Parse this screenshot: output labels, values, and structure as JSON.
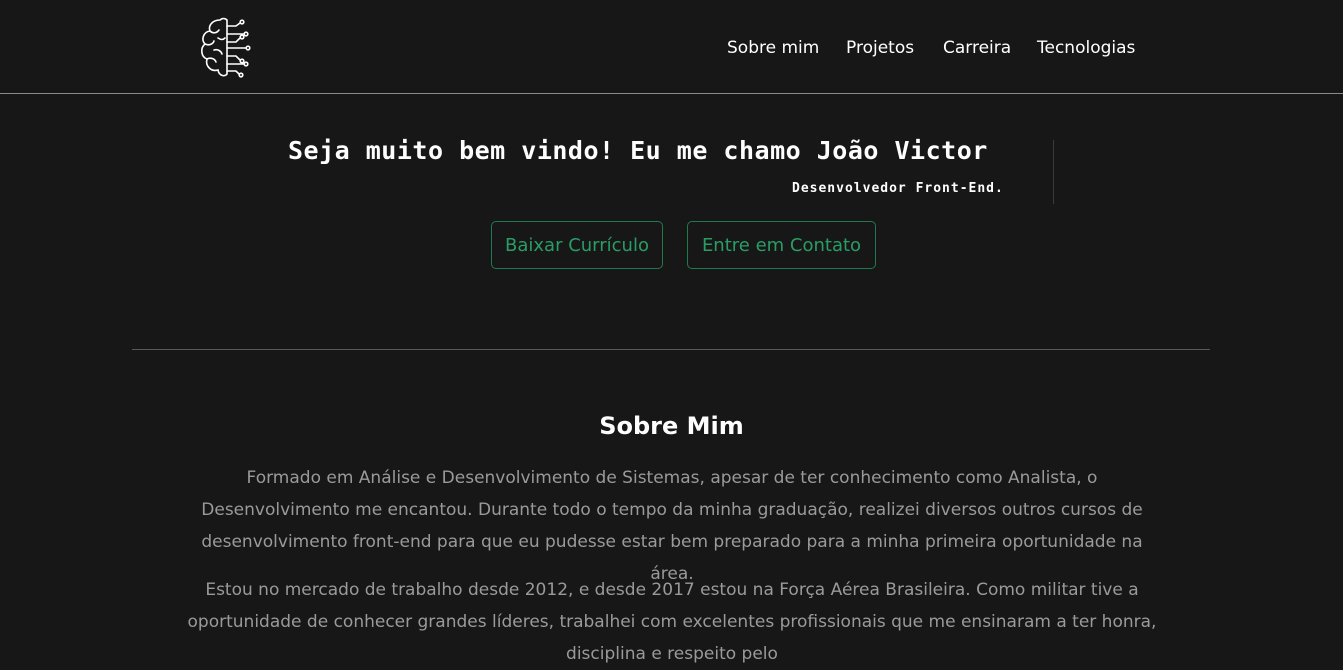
{
  "nav": {
    "logo": "brain-circuit-icon",
    "items": [
      {
        "label": "Sobre mim"
      },
      {
        "label": "Projetos"
      },
      {
        "label": "Carreira"
      },
      {
        "label": "Tecnologias"
      }
    ]
  },
  "hero": {
    "title": "Seja muito bem vindo! Eu me chamo João Victor",
    "subtitle": "Desenvolvedor Front-End.",
    "buttons": {
      "resume": "Baixar Currículo",
      "contact": "Entre em Contato"
    }
  },
  "about": {
    "title": "Sobre Mim",
    "paragraphs": [
      "Formado em Análise e Desenvolvimento de Sistemas, apesar de ter conhecimento como Analista, o Desenvolvimento me encantou. Durante todo o tempo da minha graduação, realizei diversos outros cursos de desenvolvimento front-end para que eu pudesse estar bem preparado para a minha primeira oportunidade na área.",
      "Estou no mercado de trabalho desde 2012, e desde 2017 estou na Força Aérea Brasileira. Como militar tive a oportunidade de conhecer grandes líderes, trabalhei com excelentes profissionais que me ensinaram a ter honra, disciplina e respeito pelo"
    ]
  },
  "colors": {
    "background": "#171717",
    "accent": "#2a9d66",
    "text_muted": "#9a9a9a"
  }
}
